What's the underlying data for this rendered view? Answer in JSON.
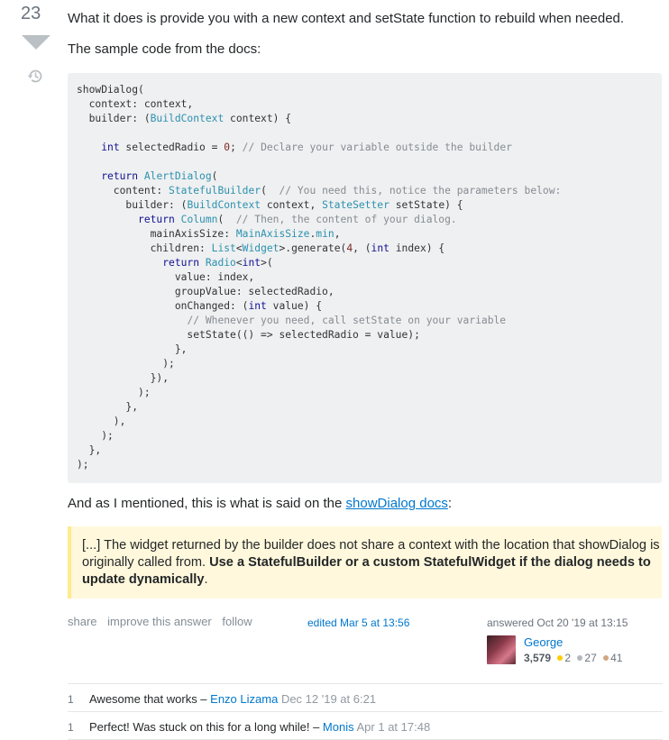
{
  "vote": {
    "count": "23"
  },
  "answer": {
    "intro": "What it does is provide you with a new context and setState function to rebuild when needed.",
    "sample_label": "The sample code from the docs:",
    "code_lines": [
      [
        [
          "p",
          "showDialog("
        ]
      ],
      [
        [
          "p",
          "  context: context,"
        ]
      ],
      [
        [
          "p",
          "  builder: ("
        ],
        [
          "t",
          "BuildContext"
        ],
        [
          "p",
          " context) {"
        ]
      ],
      [
        [
          "p",
          ""
        ]
      ],
      [
        [
          "p",
          "    "
        ],
        [
          "k",
          "int"
        ],
        [
          "p",
          " selectedRadio = "
        ],
        [
          "n",
          "0"
        ],
        [
          "p",
          "; "
        ],
        [
          "c",
          "// Declare your variable outside the builder"
        ]
      ],
      [
        [
          "p",
          ""
        ]
      ],
      [
        [
          "p",
          "    "
        ],
        [
          "k",
          "return"
        ],
        [
          "p",
          " "
        ],
        [
          "t",
          "AlertDialog"
        ],
        [
          "p",
          "("
        ]
      ],
      [
        [
          "p",
          "      content: "
        ],
        [
          "t",
          "StatefulBuilder"
        ],
        [
          "p",
          "(  "
        ],
        [
          "c",
          "// You need this, notice the parameters below:"
        ]
      ],
      [
        [
          "p",
          "        builder: ("
        ],
        [
          "t",
          "BuildContext"
        ],
        [
          "p",
          " context, "
        ],
        [
          "t",
          "StateSetter"
        ],
        [
          "p",
          " setState) {"
        ]
      ],
      [
        [
          "p",
          "          "
        ],
        [
          "k",
          "return"
        ],
        [
          "p",
          " "
        ],
        [
          "t",
          "Column"
        ],
        [
          "p",
          "(  "
        ],
        [
          "c",
          "// Then, the content of your dialog."
        ]
      ],
      [
        [
          "p",
          "            mainAxisSize: "
        ],
        [
          "t",
          "MainAxisSize"
        ],
        [
          "p",
          "."
        ],
        [
          "t",
          "min"
        ],
        [
          "p",
          ","
        ]
      ],
      [
        [
          "p",
          "            children: "
        ],
        [
          "t",
          "List"
        ],
        [
          "p",
          "<"
        ],
        [
          "t",
          "Widget"
        ],
        [
          "p",
          ">.generate("
        ],
        [
          "n",
          "4"
        ],
        [
          "p",
          ", ("
        ],
        [
          "k",
          "int"
        ],
        [
          "p",
          " index) {"
        ]
      ],
      [
        [
          "p",
          "              "
        ],
        [
          "k",
          "return"
        ],
        [
          "p",
          " "
        ],
        [
          "t",
          "Radio"
        ],
        [
          "p",
          "<"
        ],
        [
          "k",
          "int"
        ],
        [
          "p",
          ">("
        ]
      ],
      [
        [
          "p",
          "                value: index,"
        ]
      ],
      [
        [
          "p",
          "                groupValue: selectedRadio,"
        ]
      ],
      [
        [
          "p",
          "                onChanged: ("
        ],
        [
          "k",
          "int"
        ],
        [
          "p",
          " value) {"
        ]
      ],
      [
        [
          "p",
          "                  "
        ],
        [
          "c",
          "// Whenever you need, call setState on your variable"
        ]
      ],
      [
        [
          "p",
          "                  setState(() => selectedRadio = value);"
        ]
      ],
      [
        [
          "p",
          "                },"
        ]
      ],
      [
        [
          "p",
          "              );"
        ]
      ],
      [
        [
          "p",
          "            }),"
        ]
      ],
      [
        [
          "p",
          "          );"
        ]
      ],
      [
        [
          "p",
          "        },"
        ]
      ],
      [
        [
          "p",
          "      ),"
        ]
      ],
      [
        [
          "p",
          "    );"
        ]
      ],
      [
        [
          "p",
          "  },"
        ]
      ],
      [
        [
          "p",
          ");"
        ]
      ]
    ],
    "mention_text": "And as I mentioned, this is what is said on the ",
    "mention_link": "showDialog docs",
    "mention_end": ":",
    "quote_plain": "[...] The widget returned by the builder does not share a context with the location that showDialog is originally called from. ",
    "quote_bold": "Use a StatefulBuilder or a custom StatefulWidget if the dialog needs to update dynamically",
    "quote_end": "."
  },
  "post_menu": {
    "share": "share",
    "improve": "improve this answer",
    "follow": "follow"
  },
  "edited": "edited Mar 5 at 13:56",
  "user": {
    "answered": "answered Oct 20 '19 at 13:15",
    "name": "George",
    "reputation": "3,579",
    "gold": "2",
    "silver": "27",
    "bronze": "41"
  },
  "comments": [
    {
      "score": "1",
      "text": "Awesome that works – ",
      "user": "Enzo Lizama",
      "date": "Dec 12 '19 at 6:21"
    },
    {
      "score": "1",
      "text": "Perfect! Was stuck on this for a long while! – ",
      "user": "Monis",
      "date": "Apr 1 at 17:48"
    }
  ],
  "colors": {
    "link": "#0077cc",
    "code_bg": "#eff0f1",
    "quote_bg": "#fff8dc",
    "quote_border": "#ffeb8e"
  }
}
